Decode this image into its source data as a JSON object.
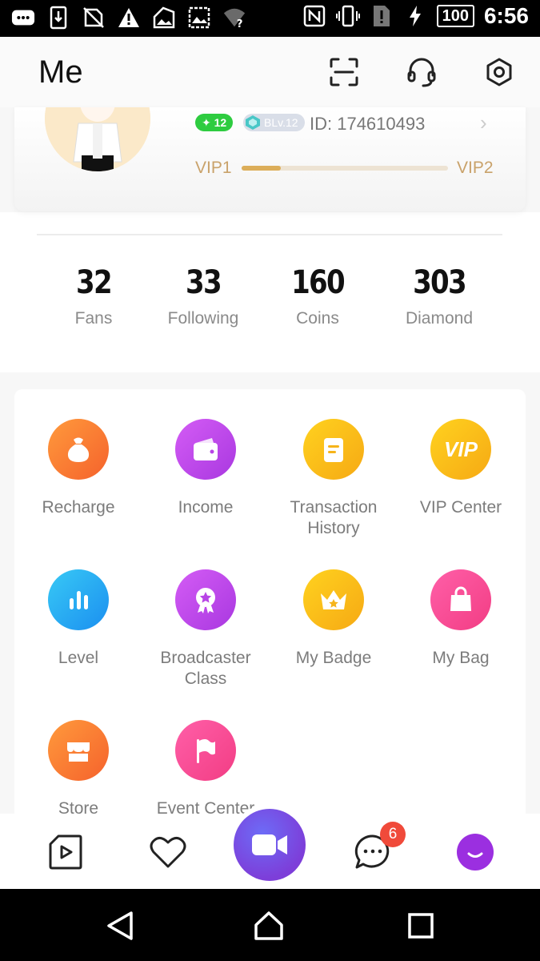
{
  "status_bar": {
    "battery": "100",
    "time": "6:56",
    "icons": [
      "messages-icon",
      "download-icon",
      "no-sim-icon",
      "warning-icon",
      "photo-icon",
      "image-icon",
      "wifi-question-icon",
      "nfc-icon",
      "vibrate-icon",
      "sim-alert-icon",
      "charging-icon"
    ]
  },
  "header": {
    "title": "Me",
    "icons": [
      "scan-icon",
      "headset-icon",
      "settings-icon"
    ]
  },
  "profile": {
    "level_badge": "12",
    "bl_badge": "BLv.12",
    "id_text": "ID: 174610493",
    "vip_current": "VIP1",
    "vip_next": "VIP2",
    "vip_progress": 0.19
  },
  "stats": [
    {
      "value": "32",
      "label": "Fans"
    },
    {
      "value": "33",
      "label": "Following"
    },
    {
      "value": "160",
      "label": "Coins"
    },
    {
      "value": "303",
      "label": "Diamond"
    }
  ],
  "menu": [
    {
      "label": "Recharge",
      "icon": "money-bag-icon",
      "color_a": "#ff9a3c",
      "color_b": "#f5622c"
    },
    {
      "label": "Income",
      "icon": "wallet-icon",
      "color_a": "#d45cf5",
      "color_b": "#a938e0"
    },
    {
      "label": "Transaction History",
      "icon": "document-icon",
      "color_a": "#ffd21f",
      "color_b": "#f6a914"
    },
    {
      "label": "VIP Center",
      "icon": "vip-icon",
      "color_a": "#ffd21f",
      "color_b": "#f6a914"
    },
    {
      "label": "Level",
      "icon": "bar-chart-icon",
      "color_a": "#38c9f5",
      "color_b": "#1b8ff0"
    },
    {
      "label": "Broadcaster Class",
      "icon": "medal-icon",
      "color_a": "#d45cf5",
      "color_b": "#a938e0"
    },
    {
      "label": "My Badge",
      "icon": "crown-icon",
      "color_a": "#ffd21f",
      "color_b": "#f6a914"
    },
    {
      "label": "My Bag",
      "icon": "shopping-bag-icon",
      "color_a": "#ff5fa8",
      "color_b": "#f23d84"
    },
    {
      "label": "Store",
      "icon": "shop-icon",
      "color_a": "#ff9a3c",
      "color_b": "#f5622c"
    },
    {
      "label": "Event Center",
      "icon": "flag-icon",
      "color_a": "#ff5fa8",
      "color_b": "#f23d84"
    }
  ],
  "bottom_nav": {
    "message_count": "6",
    "icons": [
      "video-play-icon",
      "heart-icon",
      "live-camera-icon",
      "chat-icon",
      "profile-face-icon"
    ]
  },
  "system_nav": {
    "icons": [
      "back-icon",
      "home-icon",
      "recents-icon"
    ]
  }
}
